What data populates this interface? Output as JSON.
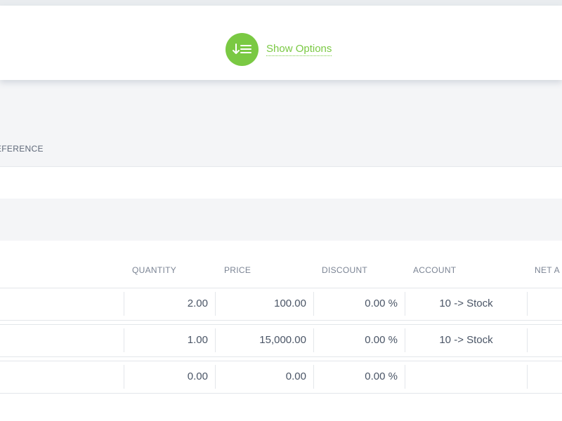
{
  "options_toggle": {
    "label": "Show Options",
    "icon": "sort-down-list-icon",
    "color": "#7ac943"
  },
  "reference_section": {
    "header_label": "EFERENCE"
  },
  "lines_table": {
    "columns": {
      "quantity": "QUANTITY",
      "price": "PRICE",
      "discount": "DISCOUNT",
      "account": "ACCOUNT",
      "net_amount": "NET A"
    },
    "rows": [
      {
        "quantity": "2.00",
        "price": "100.00",
        "discount": "0.00 %",
        "account": "10 -> Stock"
      },
      {
        "quantity": "1.00",
        "price": "15,000.00",
        "discount": "0.00 %",
        "account": "10 -> Stock"
      },
      {
        "quantity": "0.00",
        "price": "0.00",
        "discount": "0.00 %",
        "account": ""
      }
    ]
  }
}
